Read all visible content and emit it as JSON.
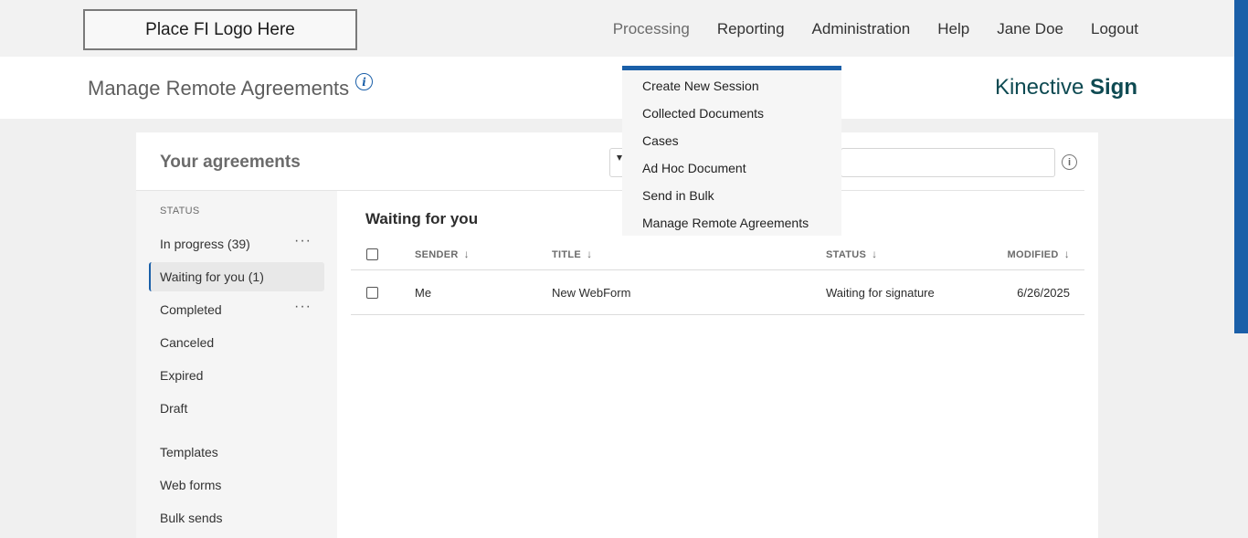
{
  "header": {
    "logo_text": "Place FI Logo Here",
    "nav": [
      "Processing",
      "Reporting",
      "Administration",
      "Help",
      "Jane Doe",
      "Logout"
    ]
  },
  "subheader": {
    "title": "Manage Remote Agreements",
    "info_glyph": "i",
    "brand_light": "Kinective",
    "brand_bold": "Sign"
  },
  "card": {
    "title": "Your agreements",
    "search_info_glyph": "i"
  },
  "sidebar": {
    "heading": "STATUS",
    "items": [
      {
        "label": "In progress (39)",
        "has_more": true
      },
      {
        "label": "Waiting for you (1)",
        "selected": true
      },
      {
        "label": "Completed",
        "has_more": true
      },
      {
        "label": "Canceled"
      },
      {
        "label": "Expired"
      },
      {
        "label": "Draft"
      },
      {
        "label": "Templates"
      },
      {
        "label": "Web forms"
      },
      {
        "label": "Bulk sends"
      }
    ],
    "more_glyph": "···"
  },
  "content": {
    "section_title": "Waiting for you",
    "columns": [
      "SENDER",
      "TITLE",
      "STATUS",
      "MODIFIED"
    ],
    "sort_glyph": "↓",
    "rows": [
      {
        "sender": "Me",
        "title": "New WebForm",
        "status": "Waiting for signature",
        "modified": "6/26/2025"
      }
    ]
  },
  "dropdown": {
    "items": [
      "Create New Session",
      "Collected Documents",
      "Cases",
      "Ad Hoc Document",
      "Send in Bulk",
      "Manage Remote Agreements"
    ]
  },
  "colors": {
    "accent": "#1a5fa8",
    "brand": "#0e4a52"
  }
}
